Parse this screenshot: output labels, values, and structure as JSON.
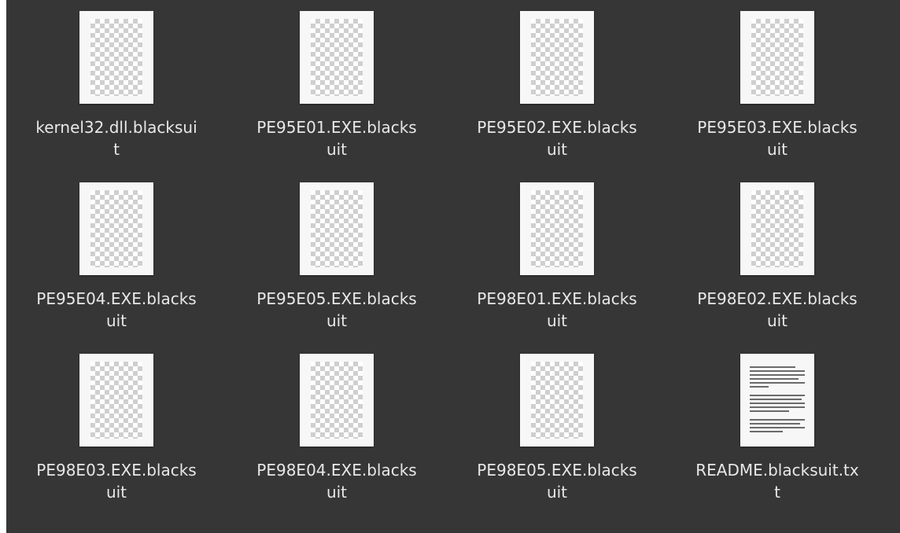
{
  "files": [
    {
      "name": "kernel32.dll.blacksuit",
      "line1": "kernel32.dll.blacksui",
      "line2": "t",
      "icon": "image-icon"
    },
    {
      "name": "PE95E01.EXE.blacksuit",
      "line1": "PE95E01.EXE.blacks",
      "line2": "uit",
      "icon": "image-icon"
    },
    {
      "name": "PE95E02.EXE.blacksuit",
      "line1": "PE95E02.EXE.blacks",
      "line2": "uit",
      "icon": "image-icon"
    },
    {
      "name": "PE95E03.EXE.blacksuit",
      "line1": "PE95E03.EXE.blacks",
      "line2": "uit",
      "icon": "image-icon"
    },
    {
      "name": "PE95E04.EXE.blacksuit",
      "line1": "PE95E04.EXE.blacks",
      "line2": "uit",
      "icon": "image-icon"
    },
    {
      "name": "PE95E05.EXE.blacksuit",
      "line1": "PE95E05.EXE.blacks",
      "line2": "uit",
      "icon": "image-icon"
    },
    {
      "name": "PE98E01.EXE.blacksuit",
      "line1": "PE98E01.EXE.blacks",
      "line2": "uit",
      "icon": "image-icon"
    },
    {
      "name": "PE98E02.EXE.blacksuit",
      "line1": "PE98E02.EXE.blacks",
      "line2": "uit",
      "icon": "image-icon"
    },
    {
      "name": "PE98E03.EXE.blacksuit",
      "line1": "PE98E03.EXE.blacks",
      "line2": "uit",
      "icon": "image-icon"
    },
    {
      "name": "PE98E04.EXE.blacksuit",
      "line1": "PE98E04.EXE.blacks",
      "line2": "uit",
      "icon": "image-icon"
    },
    {
      "name": "PE98E05.EXE.blacksuit",
      "line1": "PE98E05.EXE.blacks",
      "line2": "uit",
      "icon": "image-icon"
    },
    {
      "name": "README.blacksuit.txt",
      "line1": "README.blacksuit.tx",
      "line2": "t",
      "icon": "text-document-icon"
    }
  ],
  "colors": {
    "background": "#363636",
    "label_text": "#e8e8e8"
  }
}
